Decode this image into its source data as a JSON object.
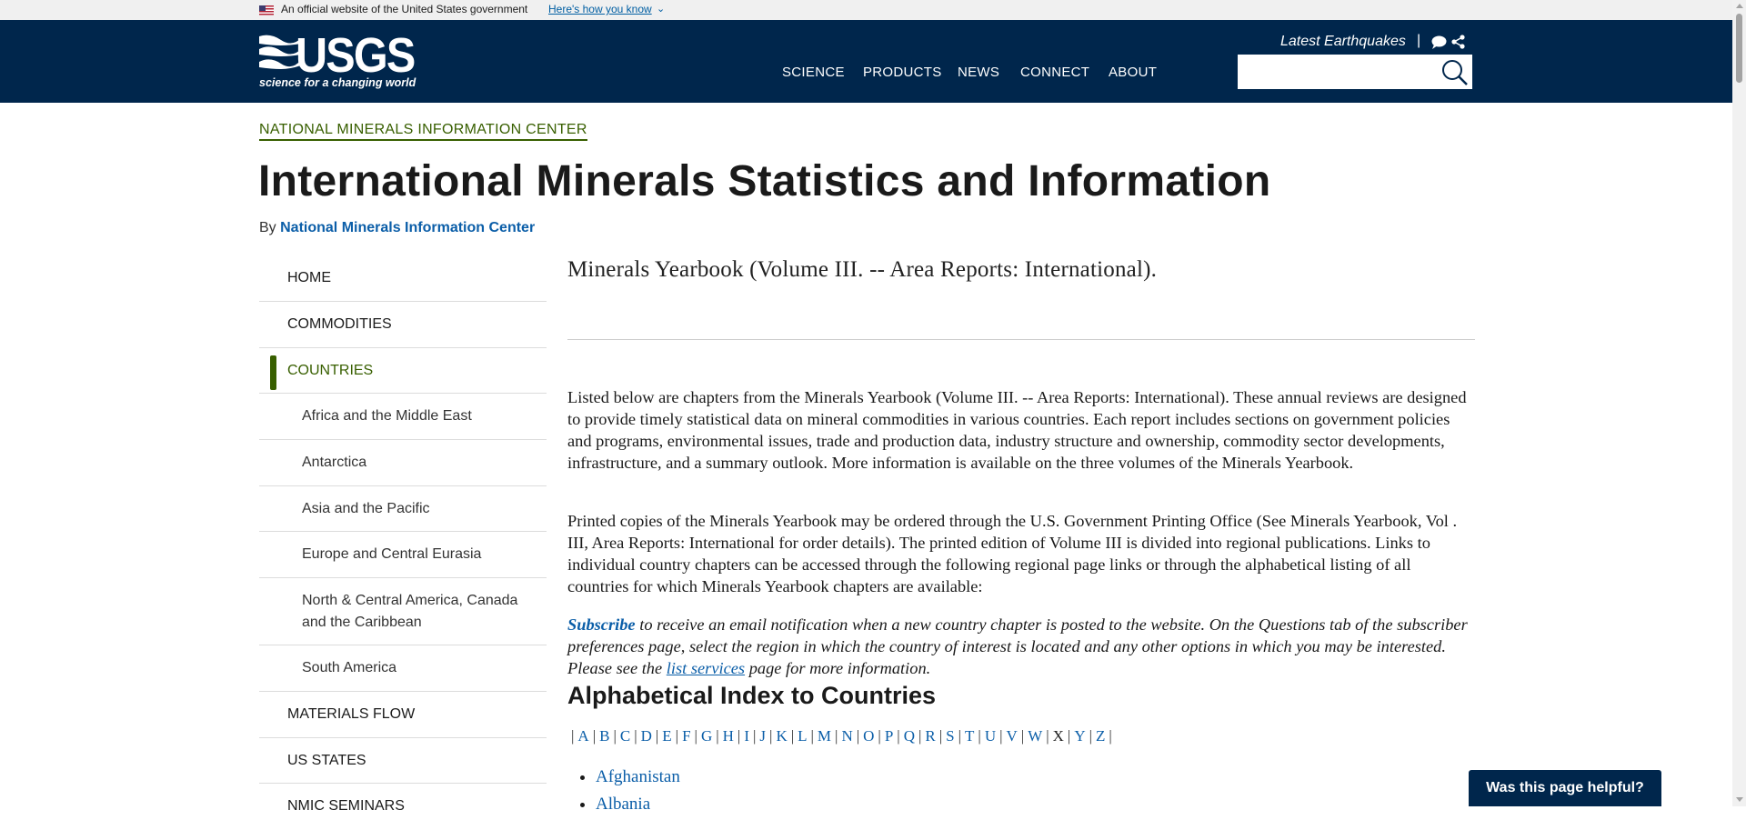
{
  "gov_banner": {
    "text": "An official website of the United States government",
    "link": "Here's how you know"
  },
  "header": {
    "logo_text": "USGS",
    "logo_tagline": "science for a changing world",
    "nav": [
      "SCIENCE",
      "PRODUCTS",
      "NEWS",
      "CONNECT",
      "ABOUT"
    ],
    "latest_link": "Latest Earthquakes",
    "separator": "|",
    "search_value": ""
  },
  "breadcrumb": "NATIONAL MINERALS INFORMATION CENTER",
  "page_title": "International Minerals Statistics and Information",
  "byline": {
    "prefix": "By",
    "author": "National Minerals Information Center"
  },
  "sidebar": {
    "items": [
      {
        "label": "HOME"
      },
      {
        "label": "COMMODITIES"
      },
      {
        "label": "COUNTRIES"
      },
      {
        "label": "Africa and the Middle East"
      },
      {
        "label": "Antarctica"
      },
      {
        "label": "Asia and the Pacific"
      },
      {
        "label": "Europe and Central Eurasia"
      },
      {
        "label": "North & Central America, Canada and the Caribbean"
      },
      {
        "label": "South America"
      },
      {
        "label": "MATERIALS FLOW"
      },
      {
        "label": "US STATES"
      },
      {
        "label": "NMIC SEMINARS"
      }
    ]
  },
  "content": {
    "subtitle": "Minerals Yearbook (Volume III. -- Area Reports: International).",
    "para1": "Listed below are chapters from the Minerals Yearbook (Volume III. -- Area Reports: International). These annual reviews are designed to provide timely statistical data on mineral commodities in various countries. Each report includes sections on government policies and programs, environmental issues, trade and production data, industry structure and ownership, commodity sector developments, infrastructure, and a summary outlook. More information is available on the three volumes of the Minerals Yearbook.",
    "para2": "Printed copies of the Minerals Yearbook may be ordered through the U.S. Government Printing Office (See Minerals Yearbook, Vol . III, Area Reports: International for order details). The printed edition of Volume III is divided into regional publications. Links to individual country chapters can be accessed through the following regional page links or through the alphabetical listing of all countries for which Minerals Yearbook chapters are available:",
    "subscribe_link": "Subscribe",
    "subscribe_text1": " to receive an email notification when a new country chapter is posted to the website. On the Questions tab of the subscriber preferences page, select the region in which the country of interest is located and any other options in which you may be interested. Please see the ",
    "list_link": "list services",
    "subscribe_text2": " page for more information.",
    "index_heading": "Alphabetical Index to Countries",
    "letters": [
      "A",
      "B",
      "C",
      "D",
      "E",
      "F",
      "G",
      "H",
      "I",
      "J",
      "K",
      "L",
      "M",
      "N",
      "O",
      "P",
      "Q",
      "R",
      "S",
      "T",
      "U",
      "V",
      "W",
      "X",
      "Y",
      "Z"
    ],
    "unlinked_letter": "X",
    "countries": [
      "Afghanistan",
      "Albania"
    ]
  },
  "feedback_button": "Was this page helpful?",
  "colors": {
    "header_bg": "#00264c",
    "accent_green": "#385f00",
    "link_blue": "#0b5ea8"
  }
}
